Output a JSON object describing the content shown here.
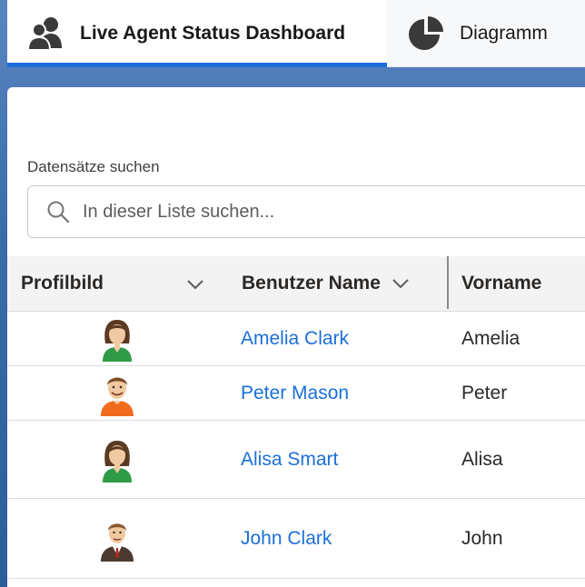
{
  "tabs": [
    {
      "label": "Live Agent Status Dashboard",
      "icon": "users-icon",
      "active": true
    },
    {
      "label": "Diagramm",
      "icon": "pie-chart-icon",
      "active": false
    }
  ],
  "search": {
    "label": "Datensätze suchen",
    "placeholder": "In dieser Liste suchen..."
  },
  "table": {
    "columns": [
      {
        "label": "Profilbild"
      },
      {
        "label": "Benutzer Name"
      },
      {
        "label": "Vorname"
      }
    ],
    "rows": [
      {
        "avatar": "female-avatar-icon",
        "name": "Amelia Clark",
        "first_name": "Amelia"
      },
      {
        "avatar": "male-avatar-icon",
        "name": "Peter Mason",
        "first_name": "Peter"
      },
      {
        "avatar": "female-avatar-icon",
        "name": "Alisa Smart",
        "first_name": "Alisa"
      },
      {
        "avatar": "male-suit-avatar-icon",
        "name": "John Clark",
        "first_name": "John"
      }
    ]
  },
  "colors": {
    "accent": "#1b6fd9",
    "link": "#1b6fd9",
    "header_bg": "#f3f3f3"
  }
}
